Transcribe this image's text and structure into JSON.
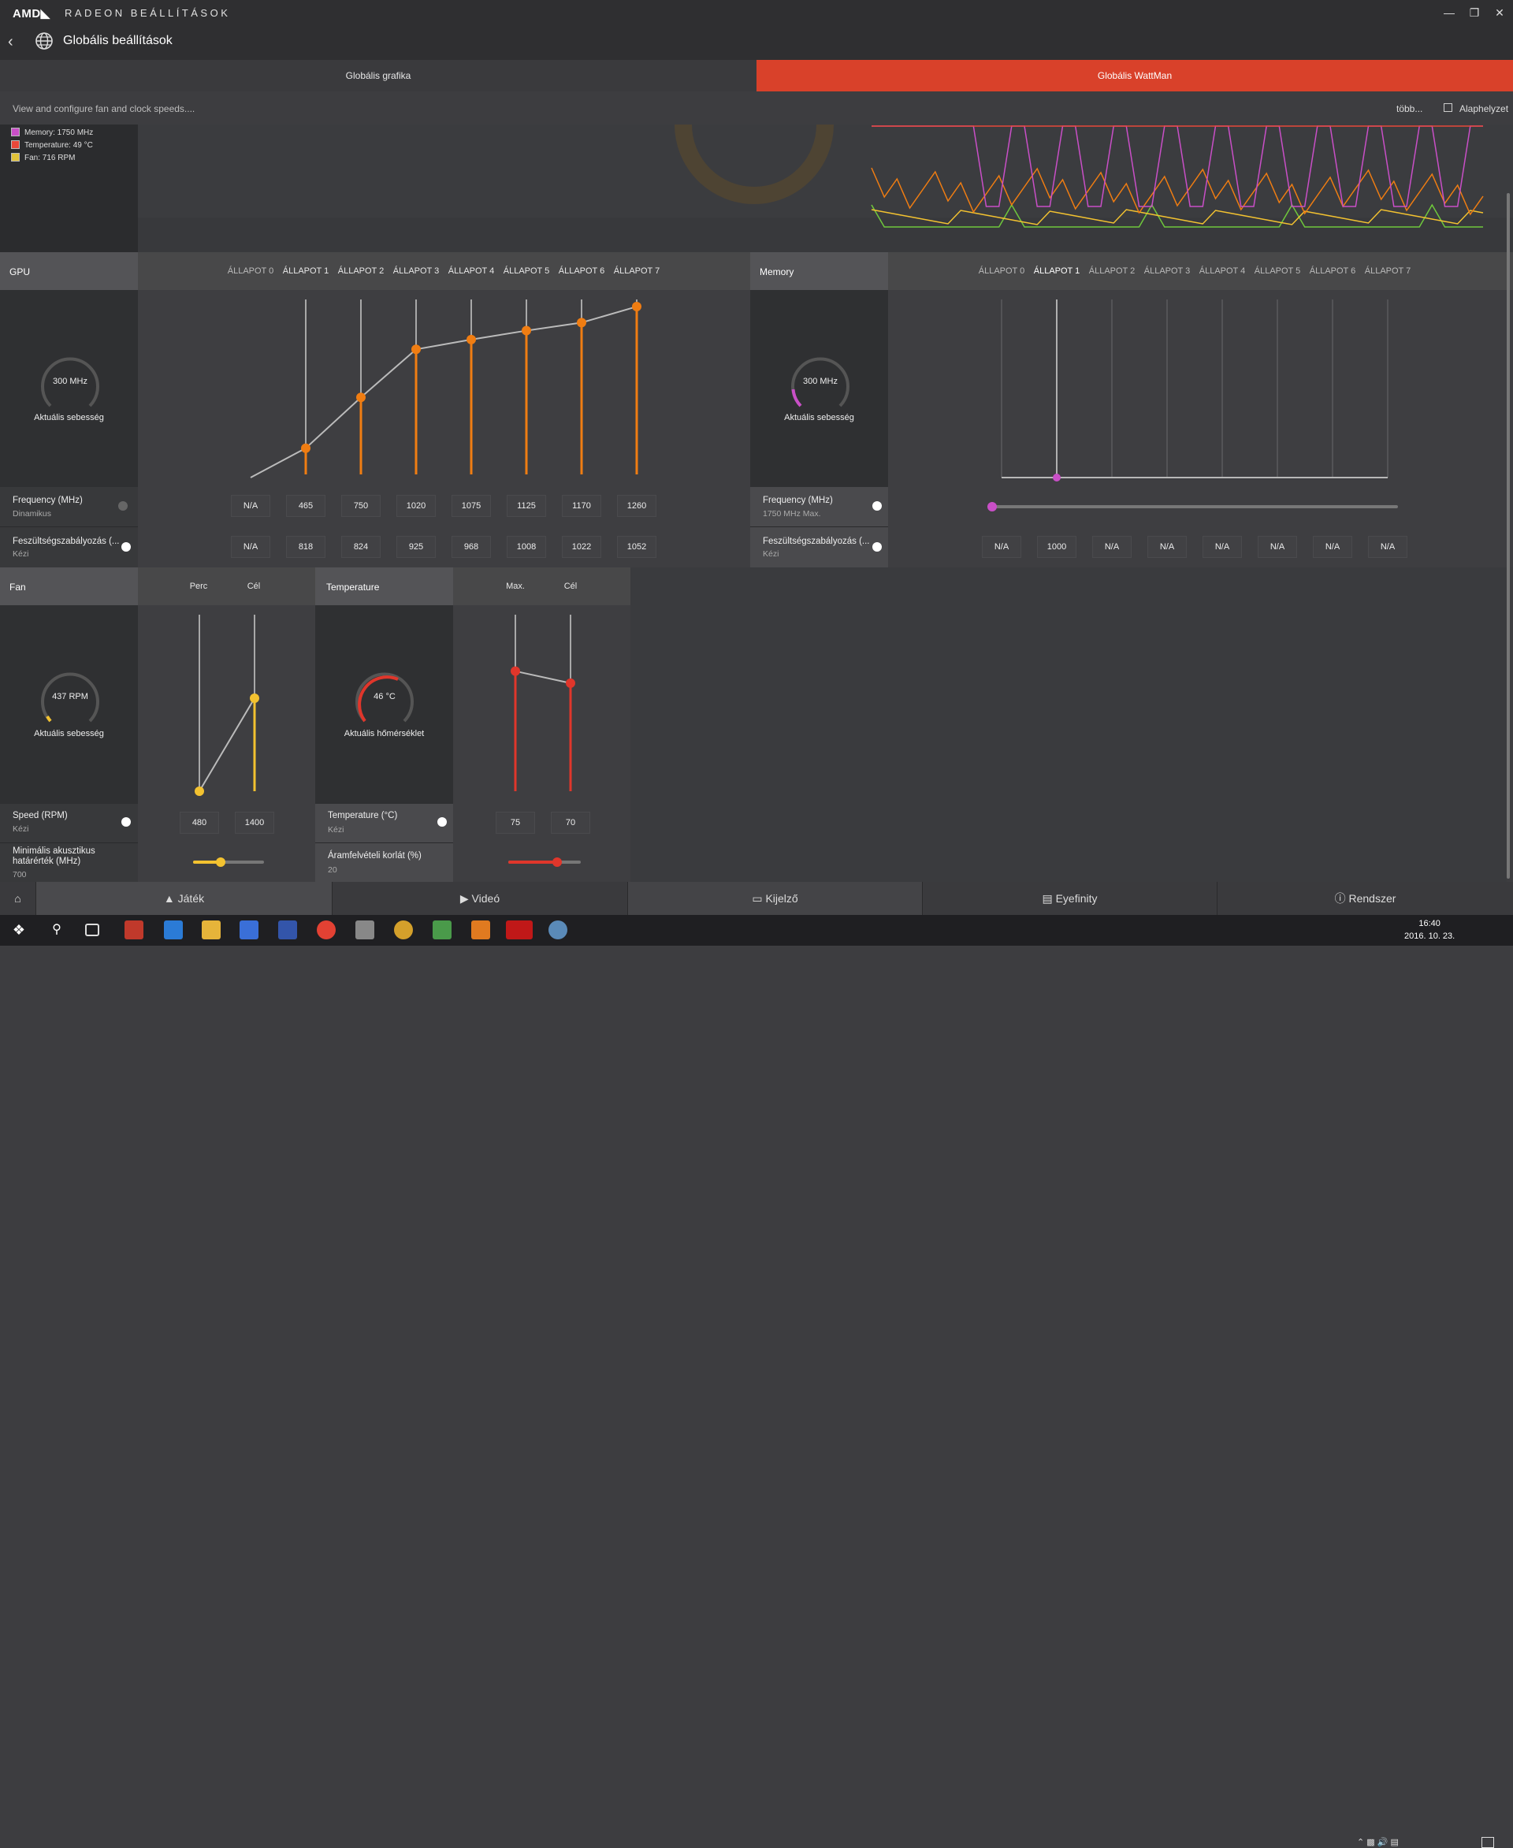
{
  "app": {
    "logo": "AMD◣",
    "title": "RADEON BEÁLLÍTÁSOK",
    "page_title": "Globális beállítások"
  },
  "tabs": [
    {
      "label": "Globális grafika",
      "active": false
    },
    {
      "label": "Globális WattMan",
      "active": true
    }
  ],
  "description": "View and configure fan and clock speeds....",
  "actions": {
    "more": "több...",
    "reset": "Alaphelyzet"
  },
  "legend": [
    {
      "label": "Memory: 1750 MHz",
      "color": "#c94fc7"
    },
    {
      "label": "Temperature: 49 °C",
      "color": "#e8483a"
    },
    {
      "label": "Fan: 716 RPM",
      "color": "#e0c23a"
    }
  ],
  "gpu": {
    "title": "GPU",
    "gauge_value": "300 MHz",
    "gauge_label": "Aktuális sebesség",
    "states": [
      "ÁLLAPOT 0",
      "ÁLLAPOT 1",
      "ÁLLAPOT 2",
      "ÁLLAPOT 3",
      "ÁLLAPOT 4",
      "ÁLLAPOT 5",
      "ÁLLAPOT 6",
      "ÁLLAPOT 7"
    ],
    "frequency": {
      "label": "Frequency (MHz)",
      "mode": "Dinamikus",
      "values": [
        "N/A",
        "465",
        "750",
        "1020",
        "1075",
        "1125",
        "1170",
        "1260"
      ]
    },
    "voltage": {
      "label": "Feszültségszabályozás (...",
      "mode": "Kézi",
      "values": [
        "N/A",
        "818",
        "824",
        "925",
        "968",
        "1008",
        "1022",
        "1052"
      ]
    }
  },
  "memory": {
    "title": "Memory",
    "gauge_value": "300 MHz",
    "gauge_label": "Aktuális sebesség",
    "states": [
      "ÁLLAPOT 0",
      "ÁLLAPOT 1",
      "ÁLLAPOT 2",
      "ÁLLAPOT 3",
      "ÁLLAPOT 4",
      "ÁLLAPOT 5",
      "ÁLLAPOT 6",
      "ÁLLAPOT 7"
    ],
    "frequency": {
      "label": "Frequency (MHz)",
      "mode": "1750 MHz Max."
    },
    "voltage": {
      "label": "Feszültségszabályozás (...",
      "mode": "Kézi",
      "values": [
        "N/A",
        "1000",
        "N/A",
        "N/A",
        "N/A",
        "N/A",
        "N/A",
        "N/A"
      ]
    }
  },
  "fan": {
    "title": "Fan",
    "col_min": "Perc",
    "col_target": "Cél",
    "gauge_value": "437 RPM",
    "gauge_label": "Aktuális sebesség",
    "speed": {
      "label": "Speed (RPM)",
      "mode": "Kézi",
      "min": "480",
      "target": "1400"
    },
    "acoustic": {
      "label": "Minimális akusztikus határérték (MHz)",
      "value": "700"
    }
  },
  "temperature": {
    "title": "Temperature",
    "col_max": "Max.",
    "col_target": "Cél",
    "gauge_value": "46 °C",
    "gauge_label": "Aktuális hőmérséklet",
    "temp": {
      "label": "Temperature (°C)",
      "mode": "Kézi",
      "max": "75",
      "target": "70"
    },
    "power": {
      "label": "Áramfelvételi korlát (%)",
      "value": "20"
    }
  },
  "bottom_nav": [
    "Játék",
    "Videó",
    "Kijelző",
    "Eyefinity",
    "Rendszer"
  ],
  "clock": {
    "time": "16:40",
    "date": "2016. 10. 23."
  },
  "colors": {
    "accent": "#d9412a",
    "orange": "#f07d12",
    "magenta": "#c94fc7",
    "yellow": "#f3c230",
    "red": "#e0362b",
    "green": "#6fc83c"
  }
}
